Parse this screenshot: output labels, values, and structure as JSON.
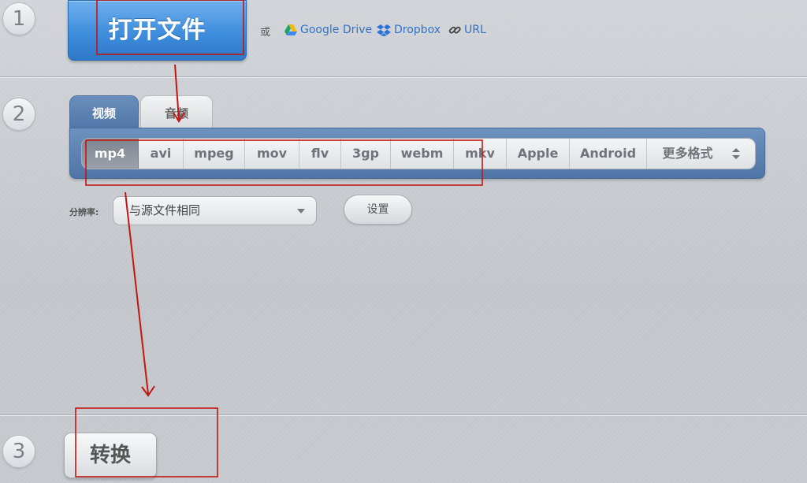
{
  "steps": [
    "1",
    "2",
    "3"
  ],
  "step1": {
    "open_label": "打开文件",
    "or_text": "或",
    "sources": [
      {
        "label": "Google Drive",
        "icon": "google-drive-icon"
      },
      {
        "label": "Dropbox",
        "icon": "dropbox-icon"
      },
      {
        "label": "URL",
        "icon": "link-icon"
      }
    ]
  },
  "step2": {
    "tabs": [
      {
        "label": "视频",
        "active": true
      },
      {
        "label": "音频",
        "active": false
      }
    ],
    "formats": [
      "mp4",
      "avi",
      "mpeg",
      "mov",
      "flv",
      "3gp",
      "webm",
      "mkv",
      "Apple",
      "Android"
    ],
    "selected_format": "mp4",
    "more_formats_label": "更多格式",
    "resolution_label": "分辨率:",
    "resolution_value": "与源文件相同",
    "settings_label": "设置"
  },
  "step3": {
    "convert_label": "转换"
  },
  "colors": {
    "accent_blue": "#3f8ddd",
    "annotation_red": "#c0170f",
    "link_blue": "#3471c5"
  }
}
